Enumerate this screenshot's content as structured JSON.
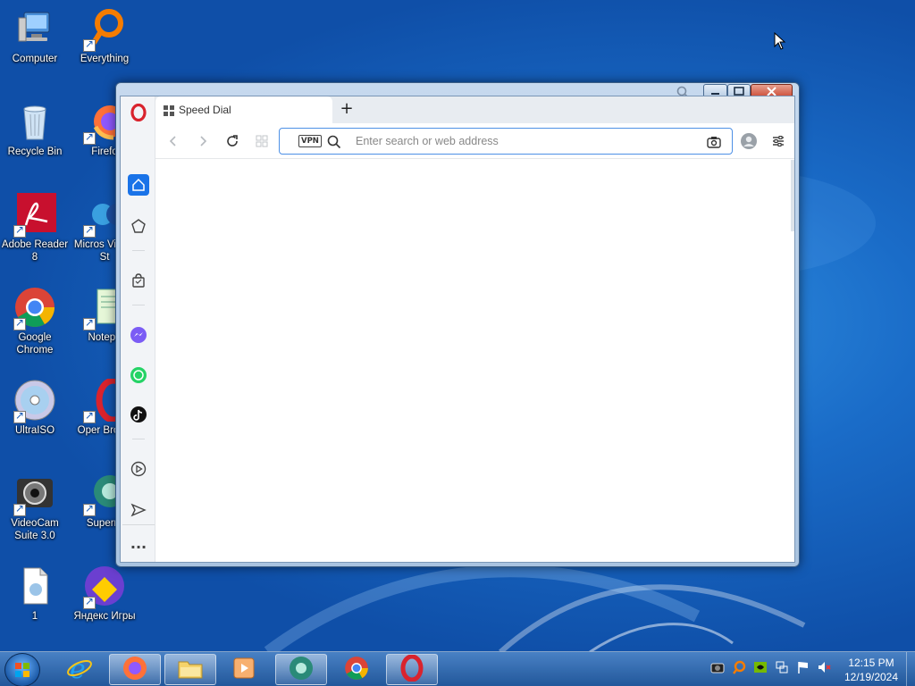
{
  "desktop": {
    "icons": [
      {
        "label": "Computer",
        "icon": "computer-icon"
      },
      {
        "label": "Everything",
        "icon": "everything-search-icon"
      },
      {
        "label": "Recycle Bin",
        "icon": "recycle-bin-icon"
      },
      {
        "label": "Firefo",
        "icon": "firefox-icon"
      },
      {
        "label": "Adobe Reader 8",
        "icon": "adobe-reader-icon"
      },
      {
        "label": "Micros Visual St",
        "icon": "visual-studio-icon"
      },
      {
        "label": "Google Chrome",
        "icon": "chrome-icon"
      },
      {
        "label": "Notepa",
        "icon": "notepad-icon"
      },
      {
        "label": "UltraISO",
        "icon": "ultraiso-icon"
      },
      {
        "label": "Oper Brows",
        "icon": "opera-icon"
      },
      {
        "label": "VideoCam Suite 3.0",
        "icon": "videocam-icon"
      },
      {
        "label": "Superm",
        "icon": "supermium-icon"
      },
      {
        "label": "1",
        "icon": "file-icon"
      },
      {
        "label": "Яндекс Игры",
        "icon": "yandex-games-icon"
      }
    ]
  },
  "browser": {
    "tab": {
      "label": "Speed Dial",
      "icon": "speed-dial-grid-icon"
    },
    "new_tab_label": "+",
    "address_bar": {
      "placeholder": "Enter search or web address",
      "value": "",
      "vpn_badge": "VPN"
    },
    "sidebar_items": [
      "home-icon",
      "pinboard-icon",
      "shopping-bag-icon",
      "messenger-icon",
      "whatsapp-icon",
      "tiktok-icon",
      "player-icon",
      "send-icon",
      "more-icon"
    ],
    "more_label": "···"
  },
  "taskbar": {
    "apps": [
      "internet-explorer-icon",
      "firefox-icon",
      "file-explorer-icon",
      "media-player-icon",
      "supermium-icon",
      "chrome-icon",
      "opera-icon"
    ],
    "clock_time": "12:15 PM",
    "clock_date": "12/19/2024"
  },
  "colors": {
    "accent": "#1a73e8",
    "opera_red": "#d9232d",
    "address_border": "#4d90e6"
  }
}
